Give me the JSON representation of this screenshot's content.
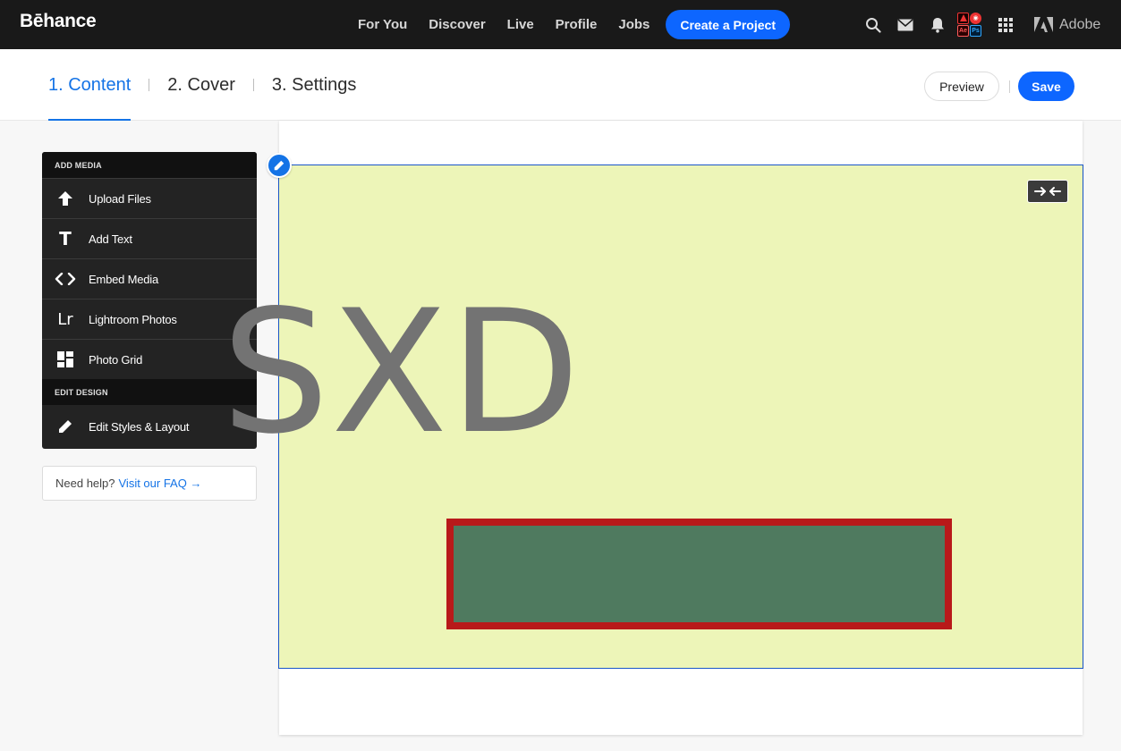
{
  "topnav": {
    "logo": "Bēhance",
    "links": [
      "For You",
      "Discover",
      "Live",
      "Profile",
      "Jobs"
    ],
    "create_label": "Create a Project",
    "icons": [
      "search-icon",
      "mail-icon",
      "bell-icon",
      "adobe-apps-icon",
      "app-grid-icon"
    ],
    "adobe_label": "Adobe",
    "accent": "#0d66ff"
  },
  "steps": {
    "items": [
      "1. Content",
      "2. Cover",
      "3. Settings"
    ],
    "active_index": 0,
    "preview_label": "Preview",
    "save_label": "Save"
  },
  "tools": {
    "add_media_header": "ADD MEDIA",
    "items": [
      {
        "label": "Upload Files",
        "icon": "upload-arrow-icon"
      },
      {
        "label": "Add Text",
        "icon": "text-t-icon"
      },
      {
        "label": "Embed Media",
        "icon": "code-brackets-icon"
      },
      {
        "label": "Lightroom Photos",
        "icon": "lightroom-icon"
      },
      {
        "label": "Photo Grid",
        "icon": "photo-grid-icon"
      }
    ],
    "edit_design_header": "EDIT DESIGN",
    "edit_item": {
      "label": "Edit Styles & Layout",
      "icon": "pencil-icon"
    },
    "lr_glyph": "Lr",
    "t_glyph": "T"
  },
  "help": {
    "text": "Need help?",
    "link": "Visit our FAQ →"
  },
  "canvas": {
    "module_text": "SXD",
    "module_bg": "#edf5b8",
    "bar_fill": "#4f7a5f",
    "bar_border": "#b8191a",
    "fullwidth_glyph": "→←"
  }
}
